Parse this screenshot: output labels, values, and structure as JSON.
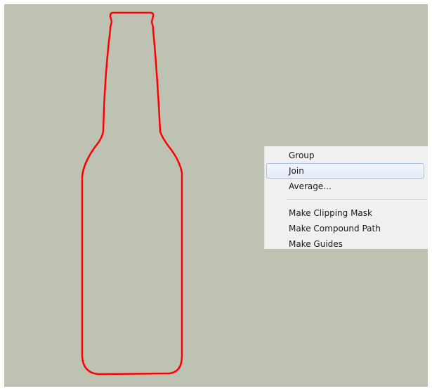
{
  "artboard": {
    "background_color": "#bdc2b3",
    "shape": "bottle-outline",
    "stroke_color": "#ff0000"
  },
  "context_menu": {
    "items": [
      {
        "label": "Group",
        "highlighted": false
      },
      {
        "label": "Join",
        "highlighted": true
      },
      {
        "label": "Average...",
        "highlighted": false
      }
    ],
    "items_after_separator": [
      {
        "label": "Make Clipping Mask"
      },
      {
        "label": "Make Compound Path"
      },
      {
        "label": "Make Guides"
      }
    ]
  }
}
